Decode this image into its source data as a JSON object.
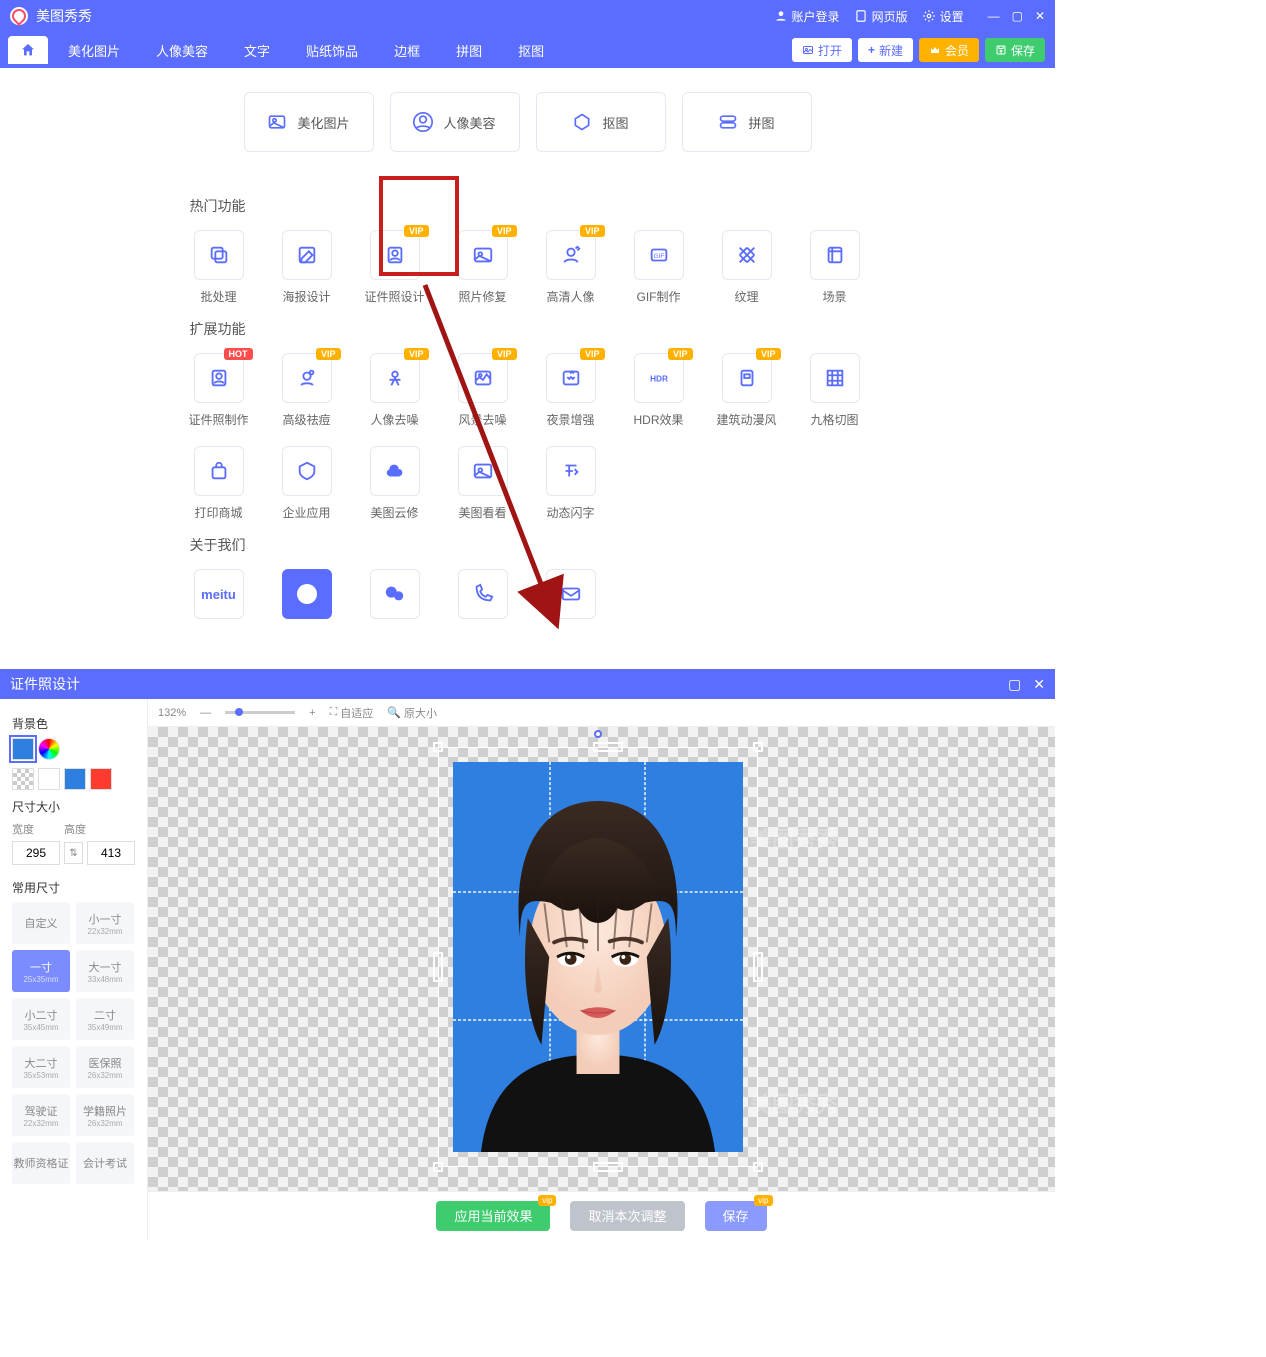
{
  "app": {
    "title": "美图秀秀"
  },
  "titlebar": {
    "login": "账户登录",
    "webver": "网页版",
    "settings": "设置"
  },
  "menu": [
    "美化图片",
    "人像美容",
    "文字",
    "贴纸饰品",
    "边框",
    "拼图",
    "抠图"
  ],
  "action_buttons": {
    "open": "打开",
    "new": "新建",
    "member": "会员",
    "save": "保存"
  },
  "big_cards": [
    "美化图片",
    "人像美容",
    "抠图",
    "拼图"
  ],
  "sections": {
    "hot": "热门功能",
    "ext": "扩展功能",
    "about": "关于我们"
  },
  "hot_tiles": [
    {
      "label": "批处理",
      "badge": null
    },
    {
      "label": "海报设计",
      "badge": null
    },
    {
      "label": "证件照设计",
      "badge": "VIP"
    },
    {
      "label": "照片修复",
      "badge": "VIP"
    },
    {
      "label": "高清人像",
      "badge": "VIP"
    },
    {
      "label": "GIF制作",
      "badge": null
    },
    {
      "label": "纹理",
      "badge": null
    },
    {
      "label": "场景",
      "badge": null
    }
  ],
  "ext_tiles": [
    {
      "label": "证件照制作",
      "badge": "HOT"
    },
    {
      "label": "高级祛痘",
      "badge": "VIP"
    },
    {
      "label": "人像去噪",
      "badge": "VIP"
    },
    {
      "label": "风景去噪",
      "badge": "VIP"
    },
    {
      "label": "夜景增强",
      "badge": "VIP"
    },
    {
      "label": "HDR效果",
      "badge": "VIP"
    },
    {
      "label": "建筑动漫风",
      "badge": "VIP"
    },
    {
      "label": "九格切图",
      "badge": null
    },
    {
      "label": "打印商城",
      "badge": null
    },
    {
      "label": "企业应用",
      "badge": null
    },
    {
      "label": "美图云修",
      "badge": null
    },
    {
      "label": "美图看看",
      "badge": null
    },
    {
      "label": "动态闪字",
      "badge": null
    }
  ],
  "about_icons": [
    "meitu",
    "logo",
    "wechat",
    "phone",
    "mail"
  ],
  "win2": {
    "title": "证件照设计",
    "zoom": "132%",
    "fit": "自适应",
    "orig": "原大小",
    "bg_label": "背景色",
    "bg_colors": [
      "#2e7fdf",
      "gradient"
    ],
    "bg_row2": [
      "checker",
      "#ffffff",
      "#2e7fdf",
      "#ff3b30"
    ],
    "bg_selected": 0,
    "size_label": "尺寸大小",
    "width_label": "宽度",
    "height_label": "高度",
    "width": "295",
    "height": "413",
    "common_label": "常用尺寸",
    "sizes": [
      {
        "t": "自定义",
        "s": ""
      },
      {
        "t": "小一寸",
        "s": "22x32mm"
      },
      {
        "t": "一寸",
        "s": "25x35mm"
      },
      {
        "t": "大一寸",
        "s": "33x48mm"
      },
      {
        "t": "小二寸",
        "s": "35x45mm"
      },
      {
        "t": "二寸",
        "s": "35x49mm"
      },
      {
        "t": "大二寸",
        "s": "35x53mm"
      },
      {
        "t": "医保照",
        "s": "26x32mm"
      },
      {
        "t": "驾驶证",
        "s": "22x32mm"
      },
      {
        "t": "学籍照片",
        "s": "26x32mm"
      },
      {
        "t": "教师资格证",
        "s": ""
      },
      {
        "t": "会计考试",
        "s": ""
      }
    ],
    "size_active": 2,
    "watermark_text": "美图秀秀",
    "actions": {
      "apply": "应用当前效果",
      "cancel": "取消本次调整",
      "save": "保存"
    }
  }
}
